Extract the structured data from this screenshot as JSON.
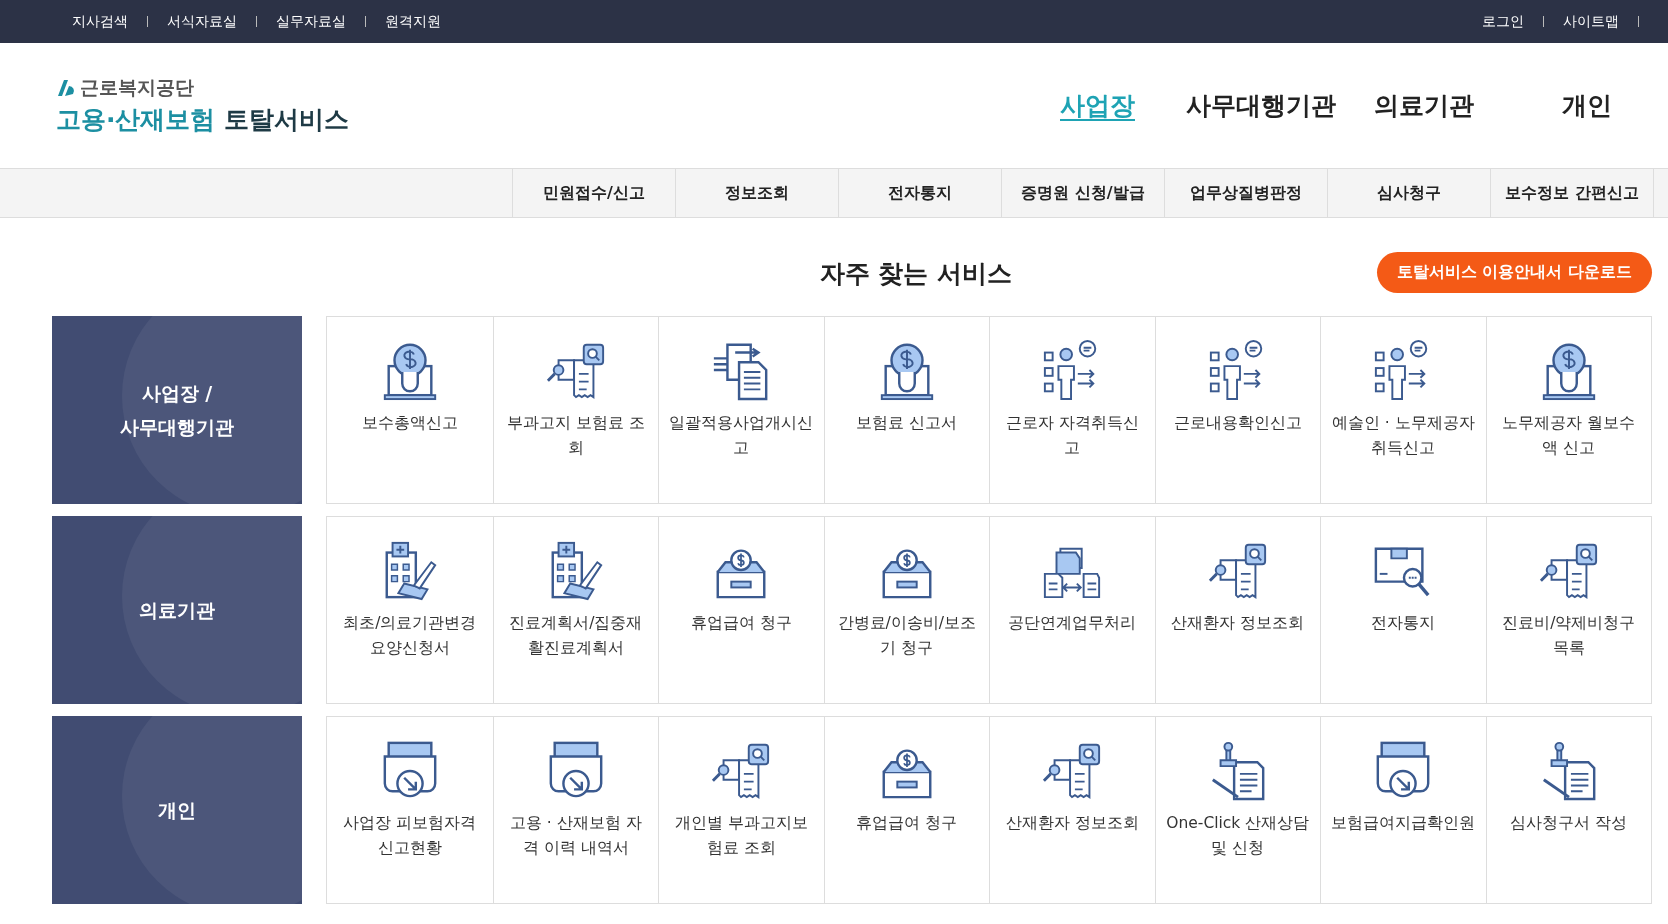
{
  "top_bar": {
    "left_links": [
      "지사검색",
      "서식자료실",
      "실무자료실",
      "원격지원"
    ],
    "right_links": [
      "로그인",
      "사이트맵"
    ]
  },
  "logo": {
    "org": "근로복지공단",
    "title_main": "고용·산재보험",
    "title_sub": "토탈서비스"
  },
  "main_nav": [
    {
      "label": "사업장",
      "selected": true
    },
    {
      "label": "사무대행기관",
      "selected": false
    },
    {
      "label": "의료기관",
      "selected": false
    },
    {
      "label": "개인",
      "selected": false
    }
  ],
  "sub_nav": [
    "민원접수/신고",
    "정보조회",
    "전자통지",
    "증명원 신청/발급",
    "업무상질병판정",
    "심사청구",
    "보수정보 간편신고"
  ],
  "section": {
    "title": "자주 찾는 서비스",
    "download_button": "토탈서비스 이용안내서 다운로드"
  },
  "groups": [
    {
      "label": "사업장 / 사무대행기관",
      "services": [
        {
          "kind": "bulb",
          "label": "보수총액신고"
        },
        {
          "kind": "docsearch",
          "label": "부과고지 보험료 조회"
        },
        {
          "kind": "docstack",
          "label": "일괄적용사업개시신고"
        },
        {
          "kind": "bulb",
          "label": "보험료 신고서"
        },
        {
          "kind": "person",
          "label": "근로자 자격취득신고"
        },
        {
          "kind": "person",
          "label": "근로내용확인신고"
        },
        {
          "kind": "person",
          "label": "예술인 · 노무제공자 취득신고"
        },
        {
          "kind": "bulb",
          "label": "노무제공자 월보수액 신고"
        }
      ]
    },
    {
      "label": "의료기관",
      "services": [
        {
          "kind": "hospital",
          "label": "최초/의료기관변경요양신청서"
        },
        {
          "kind": "hospital",
          "label": "진료계획서/집중재활진료계획서"
        },
        {
          "kind": "cashbox",
          "label": "휴업급여 청구"
        },
        {
          "kind": "cashbox",
          "label": "간병료/이송비/보조기 청구"
        },
        {
          "kind": "exchange",
          "label": "공단연계업무처리"
        },
        {
          "kind": "docsearch",
          "label": "산재환자 정보조회"
        },
        {
          "kind": "boxsearch",
          "label": "전자통지"
        },
        {
          "kind": "docsearch",
          "label": "진료비/약제비청구목록"
        }
      ]
    },
    {
      "label": "개인",
      "services": [
        {
          "kind": "tray",
          "label": "사업장 피보험자격 신고현황"
        },
        {
          "kind": "tray",
          "label": "고용 · 산재보험 자격 이력 내역서"
        },
        {
          "kind": "docsearch",
          "label": "개인별 부과고지보험료 조회"
        },
        {
          "kind": "cashbox",
          "label": "휴업급여 청구"
        },
        {
          "kind": "docsearch",
          "label": "산재환자 정보조회"
        },
        {
          "kind": "stamp",
          "label": "One-Click 산재상담 및 신청"
        },
        {
          "kind": "tray",
          "label": "보험급여지급확인원"
        },
        {
          "kind": "stamp",
          "label": "심사청구서 작성"
        }
      ]
    }
  ]
}
